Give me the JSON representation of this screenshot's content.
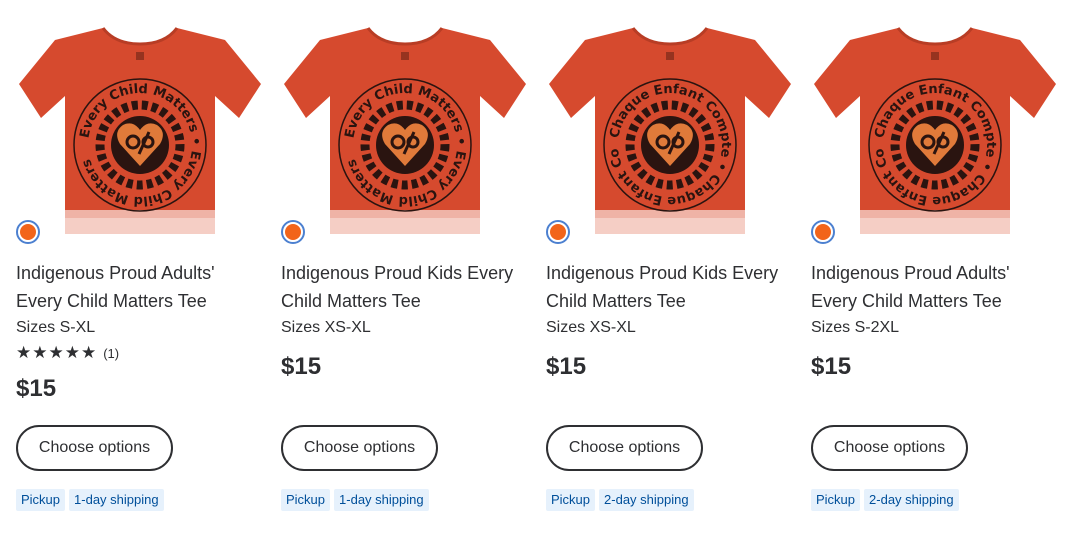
{
  "colors": {
    "swatch": "#f2641a",
    "shirt": "#d64a2e",
    "print": "#2a1410",
    "tag_bg": "#e6f1fc",
    "tag_text": "#004f9a"
  },
  "products": [
    {
      "title": "Indigenous Proud Adults' Every Child Matters Tee",
      "sizes": "Sizes S-XL",
      "rating": {
        "stars": "★★★★★",
        "count": "(1)"
      },
      "price": "$15",
      "button": "Choose options",
      "tags": [
        "Pickup",
        "1-day shipping"
      ],
      "print_text": "Every Child Matters"
    },
    {
      "title": "Indigenous Proud Kids Every Child Matters Tee",
      "sizes": "Sizes XS-XL",
      "price": "$15",
      "button": "Choose options",
      "tags": [
        "Pickup",
        "1-day shipping"
      ],
      "print_text": "Every Child Matters"
    },
    {
      "title": "Indigenous Proud Kids Every Child Matters Tee",
      "sizes": "Sizes XS-XL",
      "price": "$15",
      "button": "Choose options",
      "tags": [
        "Pickup",
        "2-day shipping"
      ],
      "print_text": "Chaque Enfant Compte"
    },
    {
      "title": "Indigenous Proud Adults' Every Child Matters Tee",
      "sizes": "Sizes S-2XL",
      "price": "$15",
      "button": "Choose options",
      "tags": [
        "Pickup",
        "2-day shipping"
      ],
      "print_text": "Chaque Enfant Compte"
    }
  ]
}
